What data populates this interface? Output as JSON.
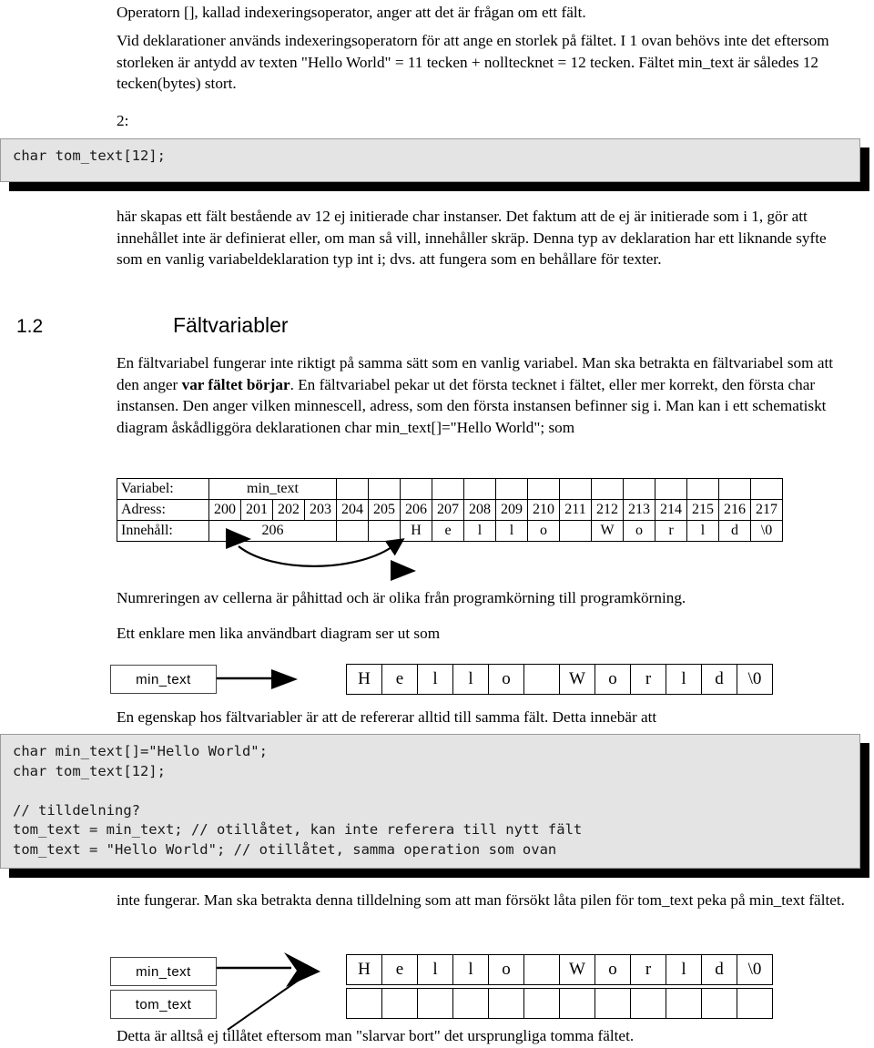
{
  "document": {
    "paragraphs": {
      "p1": "Operatorn [], kallad indexeringsoperator, anger att det är frågan om ett fält.",
      "p2": "Vid deklarationer används indexeringsoperatorn för att ange en storlek på fältet. I 1 ovan behövs inte det eftersom storleken är antydd av texten \"Hello World\" = 11 tecken + nolltecknet = 12 tecken. Fältet min_text är således 12 tecken(bytes) stort.",
      "label2": "2:",
      "p3": "här skapas ett fält bestående av 12 ej initierade char instanser. Det faktum att de ej är initierade som i 1, gör att innehållet inte är definierat eller, om man så vill, innehåller skräp. Denna typ av deklaration har ett liknande syfte som en vanlig variabeldeklaration typ int i; dvs. att fungera som en behållare för texter.",
      "p4_a": "En fältvariabel fungerar inte riktigt på samma sätt som en vanlig variabel. Man ska betrakta en fältvariabel som att den anger ",
      "p4_bold": "var fältet börjar",
      "p4_b": ". En fältvariabel pekar ut det första tecknet i fältet, eller mer korrekt, den första char instansen. Den anger vilken minnescell, adress, som den första instansen befinner sig i. Man kan i ett schematiskt diagram åskådliggöra deklarationen char min_text[]=\"Hello World\"; som",
      "p5": "Numreringen av cellerna är påhittad och är olika från programkörning till programkörning.",
      "p6": "Ett enklare men lika användbart diagram ser ut som",
      "p7": "En egenskap hos fältvariabler är att de refererar alltid till samma fält. Detta innebär att",
      "p8": "inte fungerar. Man ska betrakta denna tilldelning som att man försökt låta pilen för tom_text peka på min_text fältet.",
      "p9": "Detta är alltså ej tillåtet eftersom man \"slarvar bort\" det ursprungliga tomma fältet."
    },
    "section": {
      "number": "1.2",
      "title": "Fältvariabler"
    },
    "code_block_1": "char tom_text[12];",
    "code_block_2": "char min_text[]=\"Hello World\";\nchar tom_text[12];\n\n// tilldelning?\ntom_text = min_text; // otillåtet, kan inte referera till nytt fält\ntom_text = \"Hello World\"; // otillåtet, samma operation som ovan",
    "memory_table": {
      "row_labels": [
        "Variabel:",
        "Adress:",
        "Innehåll:"
      ],
      "variable_name": "min_text",
      "variable_span": 4,
      "addresses": [
        "200",
        "201",
        "202",
        "203",
        "204",
        "205",
        "206",
        "207",
        "208",
        "209",
        "210",
        "211",
        "212",
        "213",
        "214",
        "215",
        "216",
        "217"
      ],
      "pointer_value": "206",
      "pointer_span": 4,
      "contents": [
        "",
        "",
        "",
        "",
        "",
        "",
        "H",
        "e",
        "l",
        "l",
        "o",
        "",
        "W",
        "o",
        "r",
        "l",
        "d",
        "\\0"
      ]
    },
    "diagram_simple": {
      "box_label": "min_text",
      "cells": [
        "H",
        "e",
        "l",
        "l",
        "o",
        "",
        "W",
        "o",
        "r",
        "l",
        "d",
        "\\0"
      ]
    },
    "diagram_illegal": {
      "box_label_1": "min_text",
      "box_label_2": "tom_text",
      "cells_top": [
        "H",
        "e",
        "l",
        "l",
        "o",
        "",
        "W",
        "o",
        "r",
        "l",
        "d",
        "\\0"
      ],
      "cells_bottom": [
        "",
        "",
        "",
        "",
        "",
        "",
        "",
        "",
        "",
        "",
        "",
        ""
      ]
    }
  }
}
